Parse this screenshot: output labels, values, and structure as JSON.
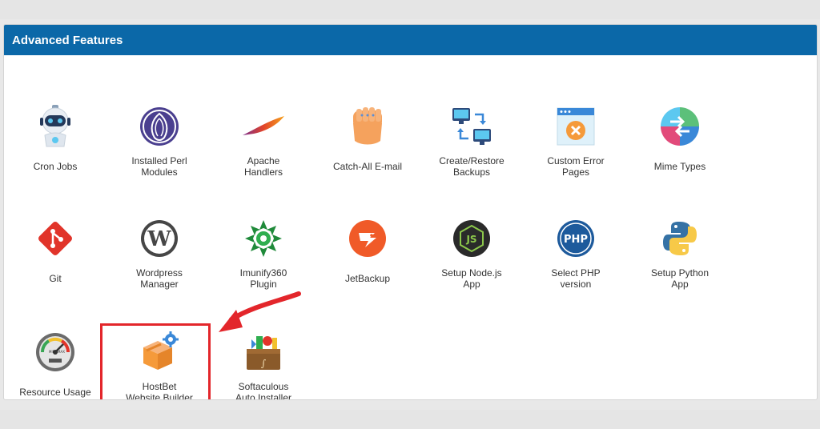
{
  "panel": {
    "title": "Advanced Features"
  },
  "tiles": [
    {
      "label": "Cron Jobs",
      "icon": "robot-icon"
    },
    {
      "label": "Installed Perl\nModules",
      "icon": "onion-icon"
    },
    {
      "label": "Apache\nHandlers",
      "icon": "feather-icon"
    },
    {
      "label": "Catch-All E-mail",
      "icon": "fist-icon"
    },
    {
      "label": "Create/Restore\nBackups",
      "icon": "computers-sync-icon"
    },
    {
      "label": "Custom Error\nPages",
      "icon": "error-page-icon"
    },
    {
      "label": "Mime Types",
      "icon": "mime-icon"
    },
    {
      "label": "Git",
      "icon": "git-icon"
    },
    {
      "label": "Wordpress\nManager",
      "icon": "wordpress-icon"
    },
    {
      "label": "Imunify360\nPlugin",
      "icon": "imunify-icon"
    },
    {
      "label": "JetBackup",
      "icon": "jetbackup-icon"
    },
    {
      "label": "Setup Node.js\nApp",
      "icon": "nodejs-icon"
    },
    {
      "label": "Select PHP\nversion",
      "icon": "php-icon"
    },
    {
      "label": "Setup Python\nApp",
      "icon": "python-icon"
    },
    {
      "label": "Resource Usage",
      "icon": "gauge-icon"
    },
    {
      "label": "HostBet\nWebsite Builder",
      "icon": "box-gear-icon"
    },
    {
      "label": "Softaculous\nAuto Installer",
      "icon": "softaculous-icon"
    }
  ],
  "gauge_text": {
    "min": "MIN",
    "max": "MAX"
  },
  "colors": {
    "header": "#0b68a8",
    "highlight": "#e3262b"
  }
}
